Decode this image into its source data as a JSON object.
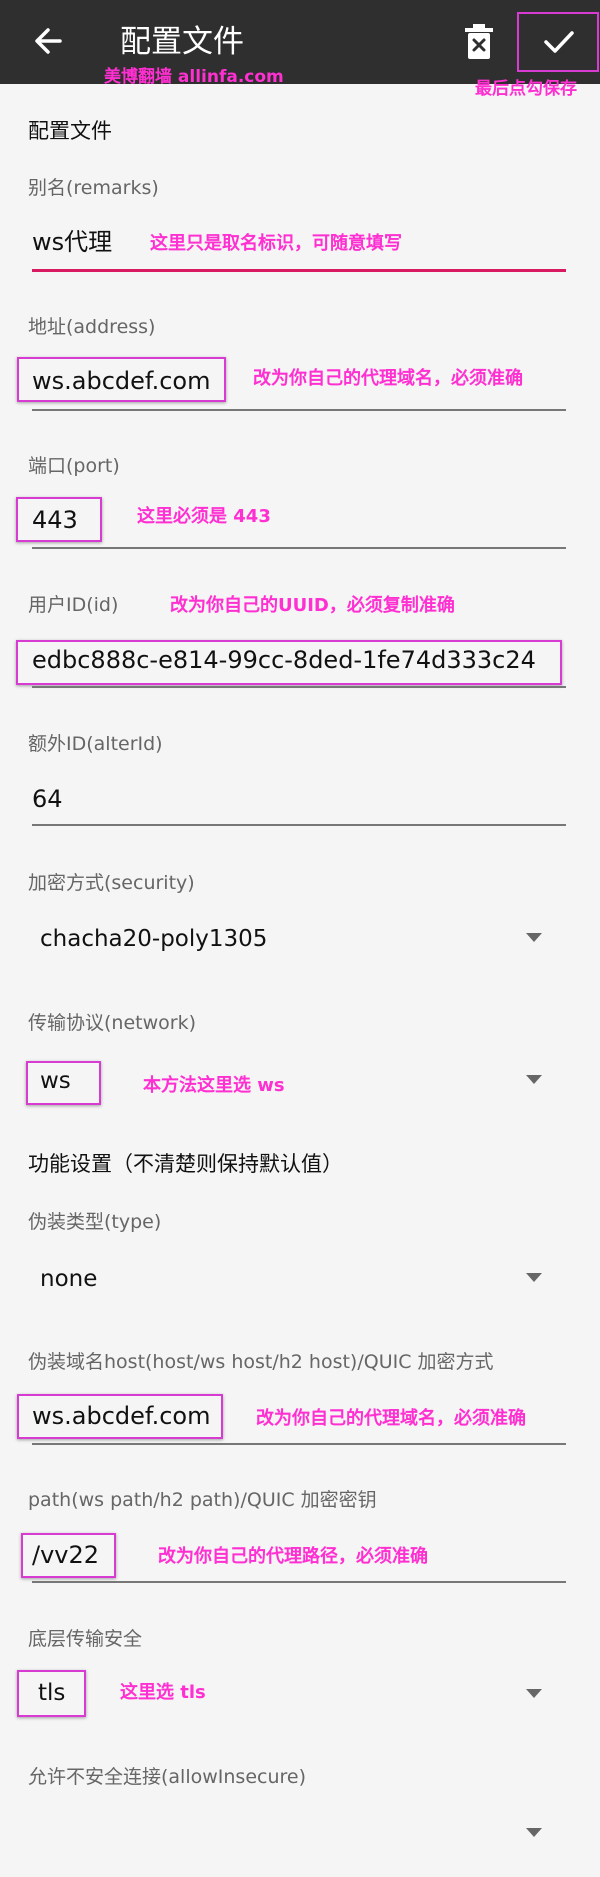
{
  "header": {
    "title": "配置文件",
    "watermark": "美博翻墙 allinfa.com",
    "save_note": "最后点勾保存"
  },
  "icons": {
    "back": "arrow-left-icon",
    "delete": "trash-x-icon",
    "save": "check-icon"
  },
  "colors": {
    "appbar": "#2f2f2f",
    "accent": "#d81b60",
    "annotation": "#ff2fd1",
    "highlight_box": "#d83bd2"
  },
  "form": {
    "section_title": "配置文件",
    "remarks": {
      "label": "别名(remarks)",
      "value": "ws代理",
      "note": "这里只是取名标识，可随意填写"
    },
    "address": {
      "label": "地址(address)",
      "value": "ws.abcdef.com",
      "note": "改为你自己的代理域名，必须准确"
    },
    "port": {
      "label": "端口(port)",
      "value": "443",
      "note": "这里必须是 443"
    },
    "user_id": {
      "label": "用户ID(id)",
      "value": "edbc888c-e814-99cc-8ded-1fe74d333c24",
      "note": "改为你自己的UUID，必须复制准确"
    },
    "alter_id": {
      "label": "额外ID(alterId)",
      "value": "64"
    },
    "security": {
      "label": "加密方式(security)",
      "value": "chacha20-poly1305"
    },
    "network": {
      "label": "传输协议(network)",
      "value": "ws",
      "note": "本方法这里选 ws"
    },
    "feature_section_title": "功能设置（不清楚则保持默认值）",
    "header_type": {
      "label": "伪装类型(type)",
      "value": "none"
    },
    "host": {
      "label": "伪装域名host(host/ws host/h2 host)/QUIC 加密方式",
      "value": "ws.abcdef.com",
      "note": "改为你自己的代理域名，必须准确"
    },
    "path": {
      "label": "path(ws path/h2 path)/QUIC 加密密钥",
      "value": "/vv22",
      "note": "改为你自己的代理路径，必须准确"
    },
    "stream_security": {
      "label": "底层传输安全",
      "value": "tls",
      "note": "这里选 tls"
    },
    "allow_insecure": {
      "label": "允许不安全连接(allowInsecure)",
      "value": ""
    }
  }
}
